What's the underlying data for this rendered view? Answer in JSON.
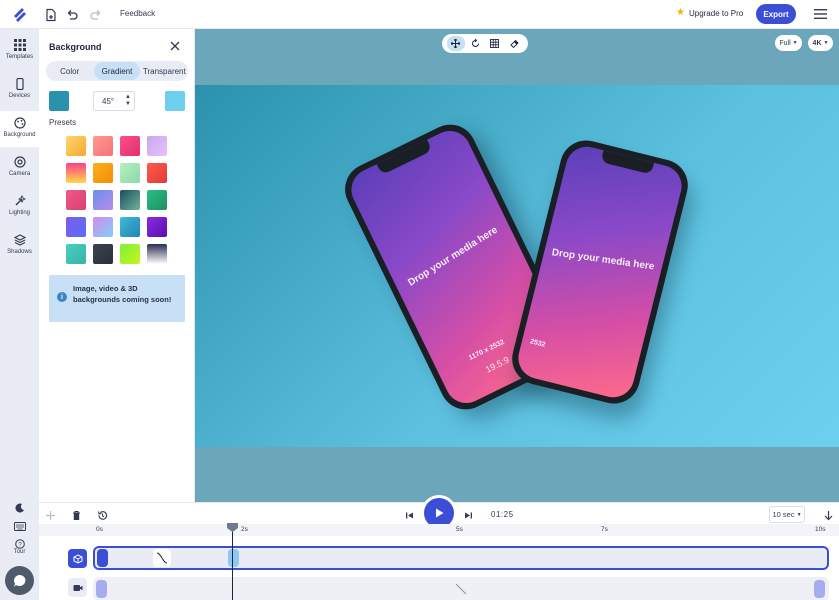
{
  "topbar": {
    "feedback_label": "Feedback",
    "upgrade_label": "Upgrade to Pro",
    "export_label": "Export"
  },
  "rail": {
    "items": [
      {
        "label": "Templates",
        "icon": "grid-icon"
      },
      {
        "label": "Devices",
        "icon": "phone-icon"
      },
      {
        "label": "Background",
        "icon": "palette-icon",
        "active": true
      },
      {
        "label": "Camera",
        "icon": "camera-icon"
      },
      {
        "label": "Lighting",
        "icon": "wand-icon"
      },
      {
        "label": "Shadows",
        "icon": "layers-icon"
      }
    ],
    "tour_label": "Tour"
  },
  "panel": {
    "title": "Background",
    "tabs": [
      "Color",
      "Gradient",
      "Transparent"
    ],
    "active_tab": "Gradient",
    "color_a": "#2b92ad",
    "angle_value": "45°",
    "color_b": "#6dd0ef",
    "presets_label": "Presets",
    "presets": [
      "linear-gradient(135deg,#ffd66b,#f7a735)",
      "linear-gradient(135deg,#ff9a8b,#f5727a)",
      "linear-gradient(135deg,#ff4e8a,#e0306a)",
      "linear-gradient(135deg,#c9a7f2,#e6c3f7)",
      "linear-gradient(180deg,#ff3f8e,#ffd84a)",
      "linear-gradient(135deg,#f9b21c,#f58a07)",
      "linear-gradient(135deg,#b8f0c0,#8ad9a8)",
      "linear-gradient(135deg,#ff5b4a,#e23b3b)",
      "linear-gradient(135deg,#ee5a8a,#d9406e)",
      "linear-gradient(135deg,#6a8fe8,#b68df0)",
      "linear-gradient(135deg,#1e4c60,#6fb49a)",
      "linear-gradient(135deg,#2bbf8a,#1e8e5f)",
      "linear-gradient(135deg,#7a5cf0,#5b6ef5)",
      "linear-gradient(135deg,#d58af0,#7fd0f5)",
      "linear-gradient(135deg,#42b8d8,#1e86b5)",
      "linear-gradient(135deg,#8a2be2,#5a10b0)",
      "linear-gradient(135deg,#46d0c0,#3ab1a8)",
      "linear-gradient(135deg,#3c4250,#2a2f3a)",
      "linear-gradient(135deg,#7ef03a,#c7f51c)",
      "linear-gradient(180deg,#2b2e52,#ffffff)"
    ],
    "info_text": "Image, video & 3D backgrounds coming soon!"
  },
  "canvas": {
    "background": "linear-gradient(135deg, #2b92ad, #6dd0ef)",
    "view_mode": "Full",
    "resolution": "4K",
    "phone_left": {
      "drop_text": "Drop your media here",
      "dimensions": "1170 x 2532",
      "ratio": "19.5:9"
    },
    "phone_right": {
      "drop_text": "Drop your media here",
      "dimensions": "2532"
    }
  },
  "timeline": {
    "time": "01:25",
    "duration": "10 sec",
    "ticks": [
      "0s",
      "2s",
      "5s",
      "7s",
      "10s"
    ]
  },
  "colors": {
    "accent": "#3b4fd6",
    "active_tab": "#c7e0f6"
  }
}
